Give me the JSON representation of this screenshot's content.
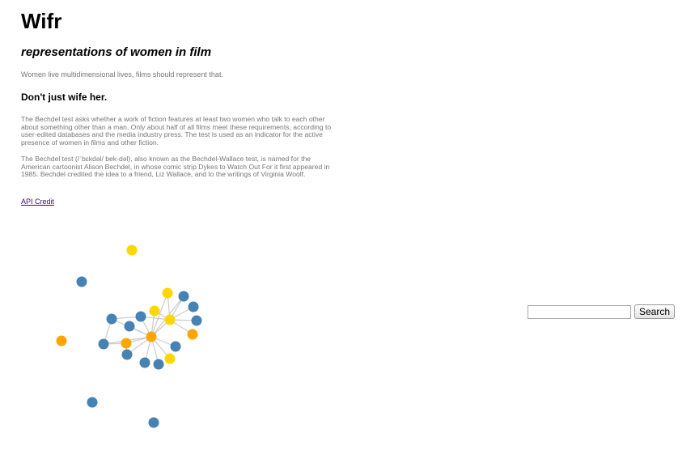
{
  "header": {
    "title": "Wifr",
    "subtitle": "representations of women in film",
    "tagline": "Women live multidimensional lives, films should represent that."
  },
  "main": {
    "heading": "Don't just wife her.",
    "paragraphs": [
      "The Bechdel test asks whether a work of fiction features at least two women who talk to each other about something other than a man. Only about half of all films meet these requirements, according to user-edited databases and the media industry press. The test is used as an indicator for the active presence of women in films and other fiction.",
      "The Bechdel test (/ˈbɛkdəl/ bek-dəl), also known as the Bechdel-Wallace test, is named for the American cartoonist Alison Bechdel, in whose comic strip Dykes to Watch Out For it first appeared in 1985. Bechdel credited the idea to a friend, Liz Wallace, and to the writings of Virginia Woolf."
    ],
    "api_link": "API Credit"
  },
  "search": {
    "placeholder": "",
    "value": "",
    "button_label": "Search"
  },
  "graph": {
    "colors": {
      "blue": "#4682b4",
      "yellow": "#ffd700",
      "orange": "#ffa500",
      "link": "#cccccc"
    }
  }
}
